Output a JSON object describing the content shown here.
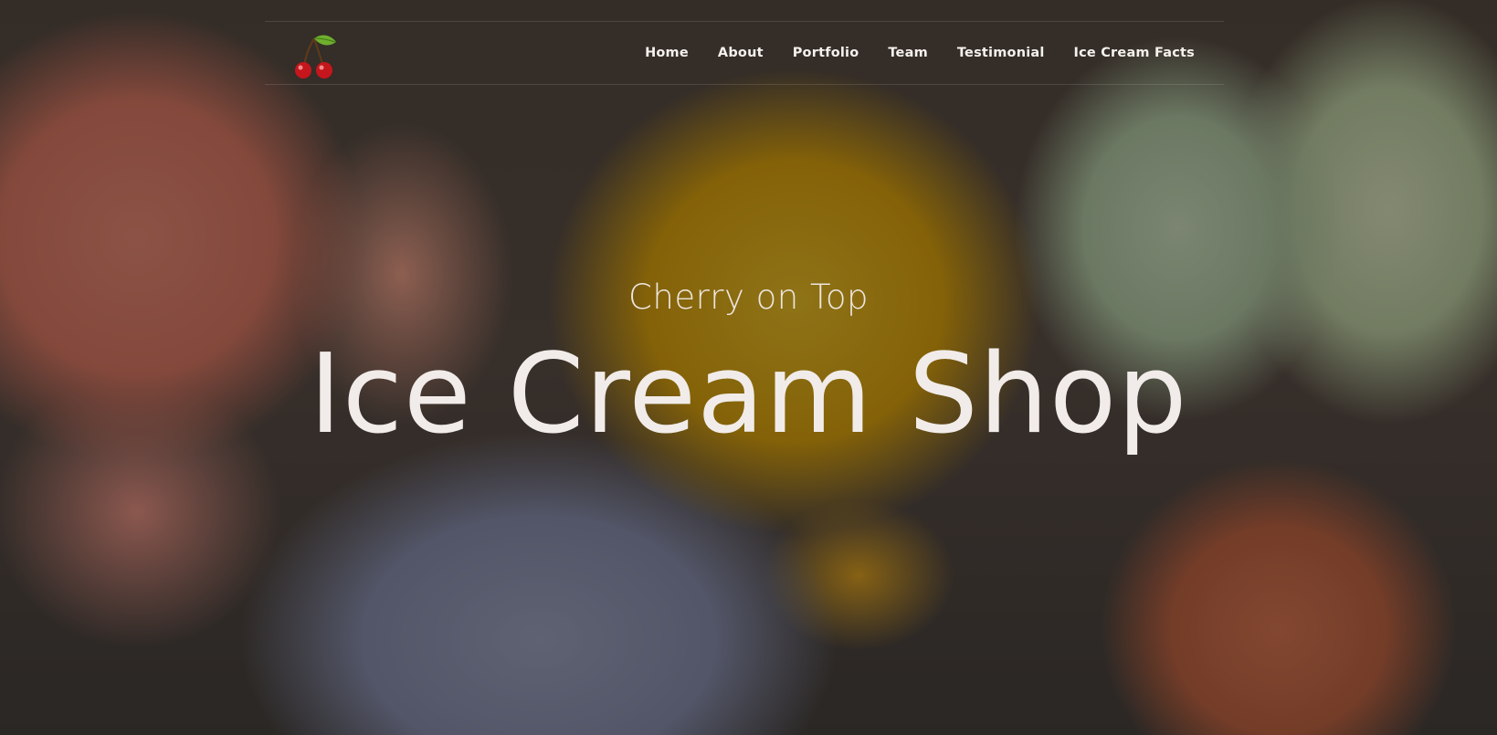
{
  "header": {
    "logo_icon": "cherries-icon",
    "nav": [
      {
        "label": "Home"
      },
      {
        "label": "About"
      },
      {
        "label": "Portfolio"
      },
      {
        "label": "Team"
      },
      {
        "label": "Testimonial"
      },
      {
        "label": "Ice Cream Facts"
      }
    ]
  },
  "hero": {
    "tagline": "Cherry on Top",
    "title": "Ice Cream Shop",
    "background": "ice-cream-scoops-photo"
  },
  "colors": {
    "text": "#f1ece9",
    "cherry": "#c4161c",
    "leaf": "#6fae2e"
  }
}
